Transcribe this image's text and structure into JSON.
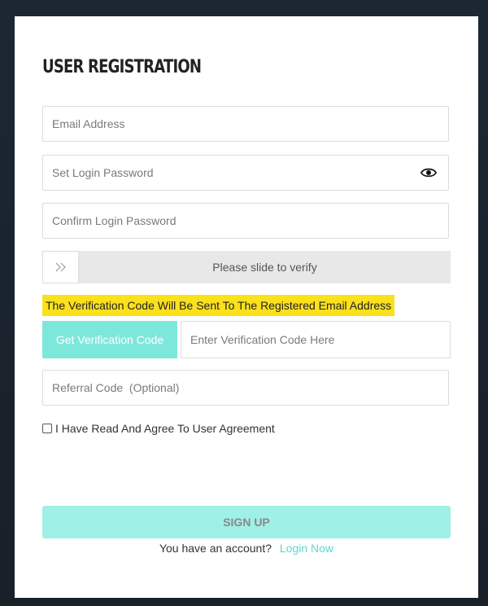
{
  "form": {
    "title": "USER REGISTRATION",
    "email_placeholder": "Email Address",
    "password_placeholder": "Set Login Password",
    "confirm_placeholder": "Confirm Login Password",
    "slider_text": "Please slide to verify",
    "slider_icon": "double-chevron-right",
    "notice": "The Verification Code Will Be Sent To The Registered Email Address",
    "get_code_label": "Get Verification Code",
    "code_placeholder": "Enter Verification Code Here",
    "referral_placeholder": "Referral Code  (Optional)",
    "agree_prefix": "I Have Read And Agree To ",
    "agree_link": "User Agreement",
    "agree_checked": false,
    "signup_label": "SIGN UP",
    "footer_text": "You have an account?",
    "login_link": "Login Now"
  },
  "colors": {
    "accent": "#7ee7dc",
    "signup_bg": "#9ff0e6",
    "link": "#5ed6cc",
    "notice_bg": "#fbe01c",
    "backdrop": "#1a2530"
  }
}
